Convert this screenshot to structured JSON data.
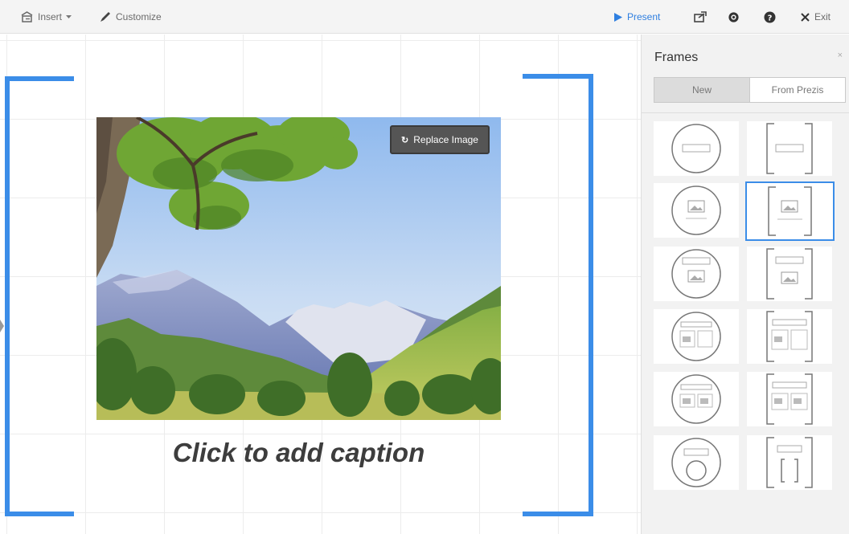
{
  "toolbar": {
    "insert_label": "Insert",
    "customize_label": "Customize",
    "present_label": "Present",
    "exit_label": "Exit",
    "accent": "#2f7fe0"
  },
  "canvas": {
    "replace_image_label": "Replace Image",
    "caption": "Click to add caption",
    "frame_color": "#3b8de8"
  },
  "panel": {
    "title": "Frames",
    "close_glyph": "×",
    "tabs": [
      "New",
      "From Prezis"
    ],
    "active_tab": "New",
    "frames": [
      {
        "shape": "circle",
        "layout": "title"
      },
      {
        "shape": "bracket",
        "layout": "title"
      },
      {
        "shape": "circle",
        "layout": "image"
      },
      {
        "shape": "bracket",
        "layout": "image",
        "selected": true
      },
      {
        "shape": "circle",
        "layout": "title-image"
      },
      {
        "shape": "bracket",
        "layout": "title-image"
      },
      {
        "shape": "circle",
        "layout": "title-image-text"
      },
      {
        "shape": "bracket",
        "layout": "title-image-text"
      },
      {
        "shape": "circle",
        "layout": "title-two-images"
      },
      {
        "shape": "bracket",
        "layout": "title-two-images"
      },
      {
        "shape": "circle",
        "layout": "title-nested-circle"
      },
      {
        "shape": "bracket",
        "layout": "title-nested-bracket"
      }
    ]
  }
}
